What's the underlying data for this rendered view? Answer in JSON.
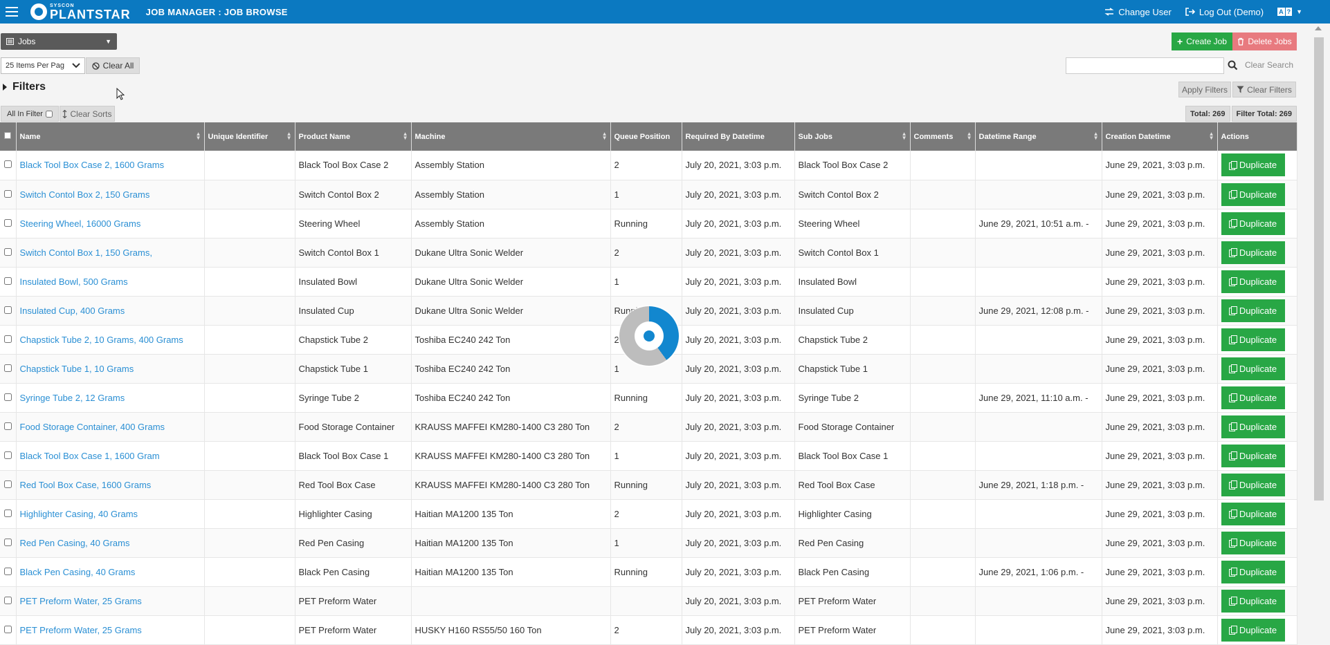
{
  "header": {
    "brand_small": "SYSCON",
    "brand_big": "PLANTSTAR",
    "title": "JOB MANAGER : JOB BROWSE",
    "change_user": "Change User",
    "log_out": "Log Out (Demo)",
    "lang_a": "A",
    "lang_b": "?"
  },
  "toolbar": {
    "view_select": "Jobs",
    "items_per_page": "25 Items Per Pag",
    "clear_all": "Clear All",
    "create_job": "Create Job",
    "delete_jobs": "Delete Jobs",
    "search_placeholder": "",
    "clear_search": "Clear Search",
    "filters": "Filters",
    "apply_filters": "Apply Filters",
    "clear_filters": "Clear Filters",
    "all_in_filter": "All In Filter",
    "clear_sorts": "Clear Sorts",
    "total": "Total: 269",
    "filter_total": "Filter Total: 269"
  },
  "table": {
    "columns": [
      "Name",
      "Unique Identifier",
      "Product Name",
      "Machine",
      "Queue Position",
      "Required By Datetime",
      "Sub Jobs",
      "Comments",
      "Datetime Range",
      "Creation Datetime",
      "Actions"
    ],
    "action_label": "Duplicate",
    "rows": [
      {
        "name": "Black Tool Box Case 2, 1600 Grams",
        "uid": "",
        "product": "Black Tool Box Case 2",
        "machine": "Assembly Station",
        "queue": "2",
        "required": "July 20, 2021, 3:03 p.m.",
        "subjobs": "Black Tool Box Case 2",
        "comments": "",
        "range": "",
        "created": "June 29, 2021, 3:03 p.m."
      },
      {
        "name": "Switch Contol Box 2, 150 Grams",
        "uid": "",
        "product": "Switch Contol Box 2",
        "machine": "Assembly Station",
        "queue": "1",
        "required": "July 20, 2021, 3:03 p.m.",
        "subjobs": "Switch Contol Box 2",
        "comments": "",
        "range": "",
        "created": "June 29, 2021, 3:03 p.m."
      },
      {
        "name": "Steering Wheel, 16000 Grams",
        "uid": "",
        "product": "Steering Wheel",
        "machine": "Assembly Station",
        "queue": "Running",
        "required": "July 20, 2021, 3:03 p.m.",
        "subjobs": "Steering Wheel",
        "comments": "",
        "range": "June 29, 2021, 10:51 a.m. -",
        "created": "June 29, 2021, 3:03 p.m."
      },
      {
        "name": "Switch Contol Box 1, 150 Grams,",
        "uid": "",
        "product": "Switch Contol Box 1",
        "machine": "Dukane Ultra Sonic Welder",
        "queue": "2",
        "required": "July 20, 2021, 3:03 p.m.",
        "subjobs": "Switch Contol Box 1",
        "comments": "",
        "range": "",
        "created": "June 29, 2021, 3:03 p.m."
      },
      {
        "name": "Insulated Bowl, 500 Grams",
        "uid": "",
        "product": "Insulated Bowl",
        "machine": "Dukane Ultra Sonic Welder",
        "queue": "1",
        "required": "July 20, 2021, 3:03 p.m.",
        "subjobs": "Insulated Bowl",
        "comments": "",
        "range": "",
        "created": "June 29, 2021, 3:03 p.m."
      },
      {
        "name": "Insulated Cup, 400 Grams",
        "uid": "",
        "product": "Insulated Cup",
        "machine": "Dukane Ultra Sonic Welder",
        "queue": "Running",
        "required": "July 20, 2021, 3:03 p.m.",
        "subjobs": "Insulated Cup",
        "comments": "",
        "range": "June 29, 2021, 12:08 p.m. -",
        "created": "June 29, 2021, 3:03 p.m."
      },
      {
        "name": "Chapstick Tube 2, 10 Grams, 400 Grams",
        "uid": "",
        "product": "Chapstick Tube 2",
        "machine": "Toshiba EC240 242 Ton",
        "queue": "2",
        "required": "July 20, 2021, 3:03 p.m.",
        "subjobs": "Chapstick Tube 2",
        "comments": "",
        "range": "",
        "created": "June 29, 2021, 3:03 p.m."
      },
      {
        "name": "Chapstick Tube 1, 10 Grams",
        "uid": "",
        "product": "Chapstick Tube 1",
        "machine": "Toshiba EC240 242 Ton",
        "queue": "1",
        "required": "July 20, 2021, 3:03 p.m.",
        "subjobs": "Chapstick Tube 1",
        "comments": "",
        "range": "",
        "created": "June 29, 2021, 3:03 p.m."
      },
      {
        "name": "Syringe Tube 2, 12 Grams",
        "uid": "",
        "product": "Syringe Tube 2",
        "machine": "Toshiba EC240 242 Ton",
        "queue": "Running",
        "required": "July 20, 2021, 3:03 p.m.",
        "subjobs": "Syringe Tube 2",
        "comments": "",
        "range": "June 29, 2021, 11:10 a.m. -",
        "created": "June 29, 2021, 3:03 p.m."
      },
      {
        "name": "Food Storage Container, 400 Grams",
        "uid": "",
        "product": "Food Storage Container",
        "machine": "KRAUSS MAFFEI KM280-1400 C3 280 Ton",
        "queue": "2",
        "required": "July 20, 2021, 3:03 p.m.",
        "subjobs": "Food Storage Container",
        "comments": "",
        "range": "",
        "created": "June 29, 2021, 3:03 p.m."
      },
      {
        "name": "Black Tool Box Case 1, 1600 Gram",
        "uid": "",
        "product": "Black Tool Box Case 1",
        "machine": "KRAUSS MAFFEI KM280-1400 C3 280 Ton",
        "queue": "1",
        "required": "July 20, 2021, 3:03 p.m.",
        "subjobs": "Black Tool Box Case 1",
        "comments": "",
        "range": "",
        "created": "June 29, 2021, 3:03 p.m."
      },
      {
        "name": "Red Tool Box Case, 1600 Grams",
        "uid": "",
        "product": "Red Tool Box Case",
        "machine": "KRAUSS MAFFEI KM280-1400 C3 280 Ton",
        "queue": "Running",
        "required": "July 20, 2021, 3:03 p.m.",
        "subjobs": "Red Tool Box Case",
        "comments": "",
        "range": "June 29, 2021, 1:18 p.m. -",
        "created": "June 29, 2021, 3:03 p.m."
      },
      {
        "name": "Highlighter Casing, 40 Grams",
        "uid": "",
        "product": "Highlighter Casing",
        "machine": "Haitian MA1200 135 Ton",
        "queue": "2",
        "required": "July 20, 2021, 3:03 p.m.",
        "subjobs": "Highlighter Casing",
        "comments": "",
        "range": "",
        "created": "June 29, 2021, 3:03 p.m."
      },
      {
        "name": "Red Pen Casing, 40 Grams",
        "uid": "",
        "product": "Red Pen Casing",
        "machine": "Haitian MA1200 135 Ton",
        "queue": "1",
        "required": "July 20, 2021, 3:03 p.m.",
        "subjobs": "Red Pen Casing",
        "comments": "",
        "range": "",
        "created": "June 29, 2021, 3:03 p.m."
      },
      {
        "name": "Black Pen Casing, 40 Grams",
        "uid": "",
        "product": "Black Pen Casing",
        "machine": "Haitian MA1200 135 Ton",
        "queue": "Running",
        "required": "July 20, 2021, 3:03 p.m.",
        "subjobs": "Black Pen Casing",
        "comments": "",
        "range": "June 29, 2021, 1:06 p.m. -",
        "created": "June 29, 2021, 3:03 p.m."
      },
      {
        "name": "PET Preform Water, 25 Grams",
        "uid": "",
        "product": "PET Preform Water",
        "machine": "",
        "queue": "",
        "required": "July 20, 2021, 3:03 p.m.",
        "subjobs": "PET Preform Water",
        "comments": "",
        "range": "",
        "created": "June 29, 2021, 3:03 p.m."
      },
      {
        "name": "PET Preform Water, 25 Grams",
        "uid": "",
        "product": "PET Preform Water",
        "machine": "HUSKY H160 RS55/50 160 Ton",
        "queue": "2",
        "required": "July 20, 2021, 3:03 p.m.",
        "subjobs": "PET Preform Water",
        "comments": "",
        "range": "",
        "created": "June 29, 2021, 3:03 p.m."
      }
    ]
  },
  "colors": {
    "brand_blue": "#0b79c1",
    "link_blue": "#2a8fd4",
    "success_green": "#28a745",
    "danger_pink": "#e87a7f",
    "header_gray": "#7a7a7a"
  },
  "icons": [
    "menu-icon",
    "plantstar-logo-icon",
    "swap-icon",
    "logout-icon",
    "language-icon",
    "list-icon",
    "ban-icon",
    "plus-icon",
    "trash-icon",
    "search-icon",
    "filter-icon",
    "sort-icon",
    "copy-icon",
    "loading-spinner-icon"
  ]
}
